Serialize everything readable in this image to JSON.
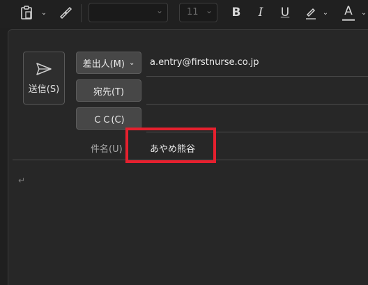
{
  "toolbar": {
    "paste_icon": "clipboard-icon",
    "format_painter_icon": "brush-icon",
    "font_name": "",
    "font_size": "11",
    "bold": "B",
    "italic": "I",
    "underline": "U",
    "highlight_icon": "highlighter-icon",
    "font_color_label": "A",
    "accent_red": "#e5202e"
  },
  "compose": {
    "send_label": "送信(S)",
    "from_label": "差出人(M)",
    "from_value": "a.entry@firstnurse.co.jp",
    "to_label": "宛先(T)",
    "to_value": "",
    "cc_label": "ＣＣ(C)",
    "cc_value": "",
    "subject_label": "件名(U)",
    "subject_value": "あやめ熊谷",
    "body_text": "↵"
  },
  "annotation": {
    "highlight_color": "#e5202e"
  }
}
